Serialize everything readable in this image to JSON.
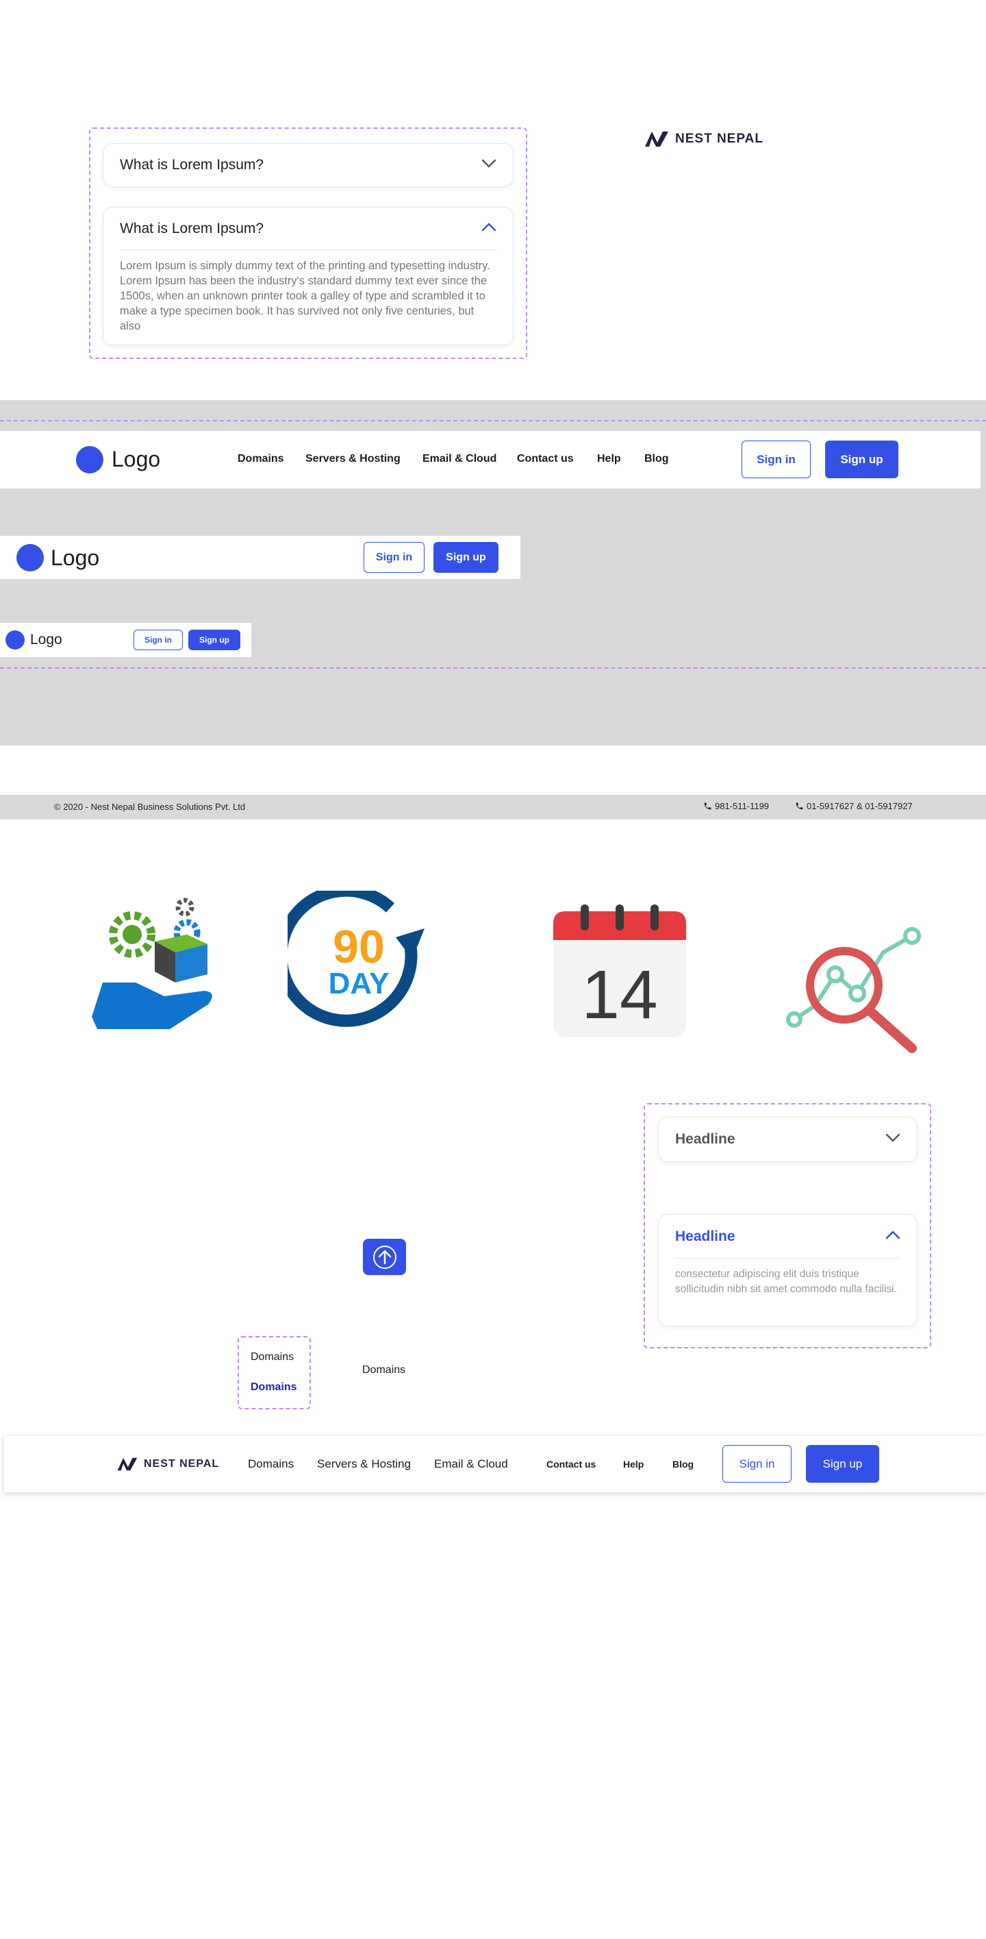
{
  "brand": {
    "name": "NEST NEPAL"
  },
  "faq1": {
    "q1": "What is Lorem Ipsum?",
    "q2": "What is Lorem Ipsum?",
    "answer": "Lorem Ipsum is simply dummy text of the printing and typesetting industry. Lorem Ipsum has been the industry's standard dummy text ever since the 1500s, when an unknown printer took a galley of type and scrambled it to make a type specimen book. It has survived not only five centuries, but also"
  },
  "nav_large": {
    "logo": "Logo",
    "links": [
      "Domains",
      "Servers & Hosting",
      "Email & Cloud",
      "Contact us",
      "Help",
      "Blog"
    ],
    "sign_in": "Sign in",
    "sign_up": "Sign up"
  },
  "nav_medium": {
    "logo": "Logo",
    "sign_in": "Sign in",
    "sign_up": "Sign up"
  },
  "nav_small": {
    "logo": "Logo",
    "sign_in": "Sign in",
    "sign_up": "Sign up"
  },
  "footer": {
    "copyright": "© 2020 - Nest Nepal Business Solutions Pvt. Ltd",
    "phone1": "981-511-1199",
    "phone2": "01-5917627 & 01-5917927"
  },
  "icons": {
    "day_number": "90",
    "day_label": "DAY",
    "calendar_day": "14"
  },
  "faq2": {
    "h1": "Headline",
    "h2": "Headline",
    "body": "consectetur adipiscing elit duis tristique sollicitudin nibh sit amet commodo nulla facilisi."
  },
  "menu_states": {
    "default": "Domains",
    "active": "Domains",
    "plain": "Domains"
  },
  "nav_final": {
    "brand": "NEST NEPAL",
    "links": [
      "Domains",
      "Servers & Hosting",
      "Email & Cloud"
    ],
    "small_links": [
      "Contact us",
      "Help",
      "Blog"
    ],
    "sign_in": "Sign in",
    "sign_up": "Sign up"
  },
  "colors": {
    "accent": "#3550e6",
    "gray_band": "#d9d9d9",
    "dashed": "#c58af0"
  }
}
